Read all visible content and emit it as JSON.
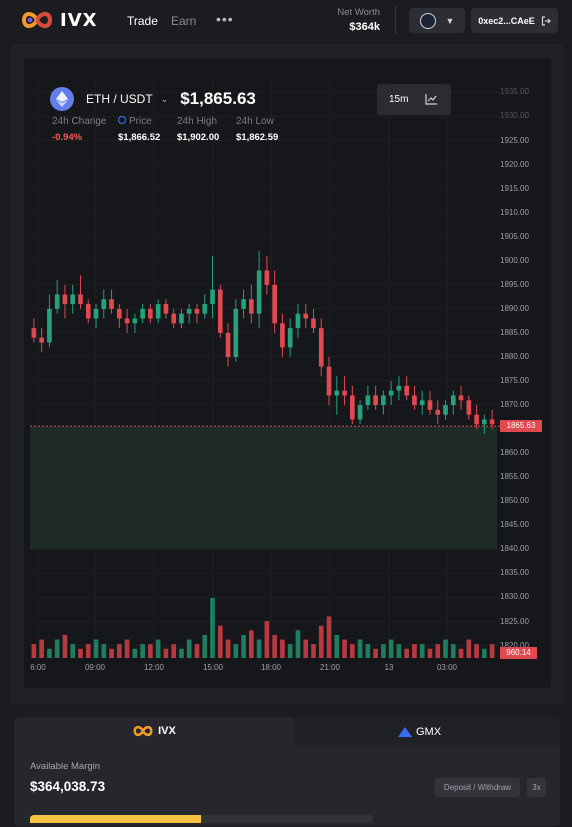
{
  "brand": {
    "name": "IVX"
  },
  "nav": {
    "trade": "Trade",
    "earn": "Earn",
    "more": "•••"
  },
  "account": {
    "net_worth_label": "Net Worth",
    "net_worth_value": "$364k",
    "wallet": "0xec2...CAeE"
  },
  "market": {
    "pair": "ETH / USDT",
    "price": "$1,865.63",
    "change_label": "24h Change",
    "change_value": "-0.94%",
    "price_label": "Price",
    "price_value": "$1,866.52",
    "high_label": "24h High",
    "high_value": "$1,902.00",
    "low_label": "24h Low",
    "low_value": "$1,862.59"
  },
  "timeframe": "15m",
  "colors": {
    "up": "#26a17b",
    "down": "#e0494f",
    "accent": "#f6c343"
  },
  "chart_data": {
    "type": "candlestick",
    "y_ticks": [
      "1935.00",
      "1930.00",
      "1925.00",
      "1920.00",
      "1915.00",
      "1910.00",
      "1905.00",
      "1900.00",
      "1895.00",
      "1890.00",
      "1885.00",
      "1880.00",
      "1875.00",
      "1870.00",
      "1865.00",
      "1860.00",
      "1855.00",
      "1850.00",
      "1845.00",
      "1840.00",
      "1835.00",
      "1830.00",
      "1825.00",
      "1820.00"
    ],
    "ylim": [
      1817,
      1938
    ],
    "x_ticks": [
      "6:00",
      "09:00",
      "12:00",
      "15:00",
      "18:00",
      "21:00",
      "13",
      "03:00"
    ],
    "current_price_label": "1865.63",
    "current_price": 1865.63,
    "volume_label": "960.14",
    "candles": [
      [
        1886,
        1888,
        1883,
        1884
      ],
      [
        1884,
        1886,
        1881,
        1883
      ],
      [
        1883,
        1893,
        1882,
        1890
      ],
      [
        1890,
        1896,
        1889,
        1893
      ],
      [
        1893,
        1895,
        1888,
        1891
      ],
      [
        1891,
        1895,
        1889,
        1893
      ],
      [
        1893,
        1897,
        1890,
        1891
      ],
      [
        1891,
        1892,
        1887,
        1888
      ],
      [
        1888,
        1891,
        1886,
        1890
      ],
      [
        1890,
        1894,
        1888,
        1892
      ],
      [
        1892,
        1894,
        1889,
        1890
      ],
      [
        1890,
        1891,
        1886,
        1888
      ],
      [
        1888,
        1890,
        1885,
        1887
      ],
      [
        1887,
        1889,
        1885,
        1888
      ],
      [
        1888,
        1891,
        1887,
        1890
      ],
      [
        1890,
        1891,
        1887,
        1888
      ],
      [
        1888,
        1892,
        1887,
        1891
      ],
      [
        1891,
        1892,
        1888,
        1889
      ],
      [
        1889,
        1890,
        1886,
        1887
      ],
      [
        1887,
        1890,
        1886,
        1889
      ],
      [
        1889,
        1891,
        1887,
        1890
      ],
      [
        1890,
        1891,
        1887,
        1889
      ],
      [
        1889,
        1893,
        1888,
        1891
      ],
      [
        1891,
        1901,
        1888,
        1894
      ],
      [
        1894,
        1895,
        1884,
        1885
      ],
      [
        1885,
        1887,
        1878,
        1880
      ],
      [
        1880,
        1892,
        1879,
        1890
      ],
      [
        1890,
        1894,
        1888,
        1892
      ],
      [
        1892,
        1895,
        1887,
        1889
      ],
      [
        1889,
        1902,
        1886,
        1898
      ],
      [
        1898,
        1901,
        1893,
        1895
      ],
      [
        1895,
        1898,
        1885,
        1887
      ],
      [
        1887,
        1889,
        1880,
        1882
      ],
      [
        1882,
        1888,
        1880,
        1886
      ],
      [
        1886,
        1891,
        1884,
        1889
      ],
      [
        1889,
        1891,
        1886,
        1888
      ],
      [
        1888,
        1890,
        1885,
        1886
      ],
      [
        1886,
        1888,
        1876,
        1878
      ],
      [
        1878,
        1880,
        1870,
        1872
      ],
      [
        1872,
        1876,
        1868,
        1873
      ],
      [
        1873,
        1876,
        1870,
        1872
      ],
      [
        1872,
        1874,
        1866,
        1867
      ],
      [
        1867,
        1871,
        1866,
        1870
      ],
      [
        1870,
        1874,
        1869,
        1872
      ],
      [
        1872,
        1874,
        1869,
        1870
      ],
      [
        1870,
        1873,
        1868,
        1872
      ],
      [
        1872,
        1875,
        1870,
        1873
      ],
      [
        1873,
        1876,
        1871,
        1874
      ],
      [
        1874,
        1876,
        1871,
        1872
      ],
      [
        1872,
        1874,
        1869,
        1870
      ],
      [
        1870,
        1873,
        1868,
        1871
      ],
      [
        1871,
        1873,
        1868,
        1869
      ],
      [
        1869,
        1871,
        1866,
        1868
      ],
      [
        1868,
        1871,
        1867,
        1870
      ],
      [
        1870,
        1873,
        1868,
        1872
      ],
      [
        1872,
        1874,
        1869,
        1871
      ],
      [
        1871,
        1872,
        1867,
        1868
      ],
      [
        1868,
        1870,
        1865,
        1866
      ],
      [
        1866,
        1868,
        1864,
        1867
      ],
      [
        1867,
        1869,
        1865,
        1866
      ]
    ],
    "volumes": [
      3,
      4,
      2,
      4,
      5,
      3,
      2,
      3,
      4,
      3,
      2,
      3,
      4,
      2,
      3,
      3,
      4,
      2,
      3,
      2,
      4,
      3,
      5,
      13,
      7,
      4,
      3,
      5,
      6,
      4,
      8,
      5,
      4,
      3,
      6,
      4,
      3,
      7,
      9,
      5,
      4,
      3,
      4,
      3,
      2,
      3,
      4,
      3,
      2,
      3,
      3,
      2,
      3,
      4,
      3,
      2,
      4,
      3,
      2,
      3
    ]
  },
  "bottom": {
    "tab_ivx": "IVX",
    "tab_gmx": "GMX",
    "available_margin_label": "Available Margin",
    "available_margin_value": "$364,038.73",
    "deposit_button": "Deposit / Withdraw",
    "leverage": "3x"
  }
}
